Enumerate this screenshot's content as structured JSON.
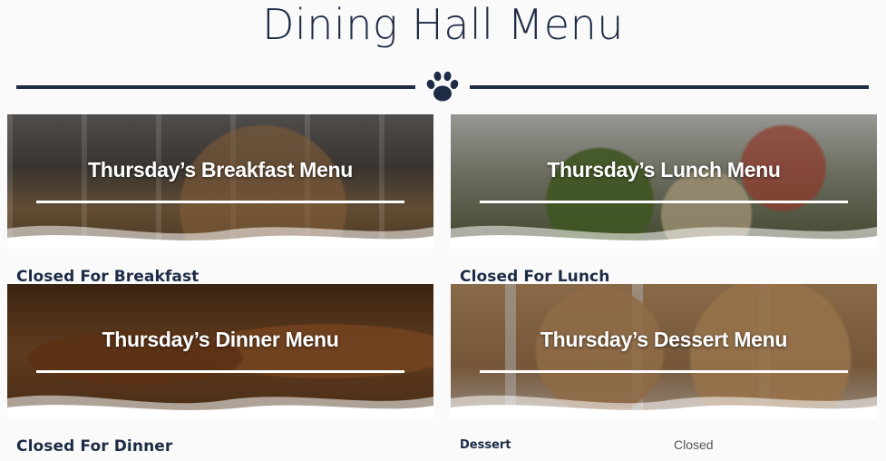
{
  "page": {
    "title": "Dining Hall Menu"
  },
  "icons": {
    "divider": "paw-icon"
  },
  "colors": {
    "navy": "#1d2b45",
    "white": "#ffffff"
  },
  "cards": {
    "breakfast": {
      "title": "Thursday’s Breakfast Menu",
      "status": "Closed For Breakfast"
    },
    "lunch": {
      "title": "Thursday’s Lunch Menu",
      "status": "Closed For Lunch"
    },
    "dinner": {
      "title": "Thursday’s Dinner Menu",
      "status": "Closed For Dinner"
    },
    "dessert": {
      "title": "Thursday’s Dessert Menu",
      "items": [
        {
          "name": "Dessert",
          "value": "Closed"
        }
      ]
    }
  }
}
